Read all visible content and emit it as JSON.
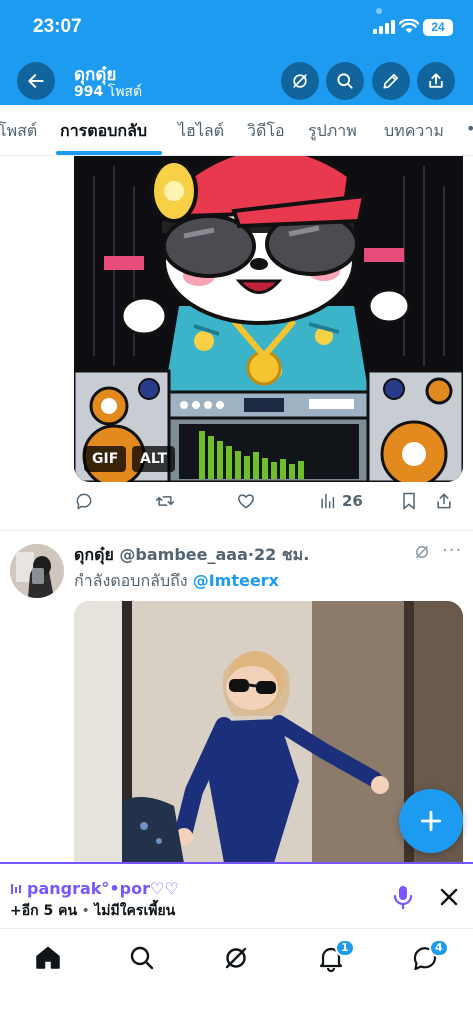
{
  "status": {
    "time": "23:07",
    "battery": "24"
  },
  "header": {
    "name": "ดุกดุ๋ย",
    "post_count": "994",
    "post_label": "โพสต์"
  },
  "tabs": [
    {
      "label": "โพสต์"
    },
    {
      "label": "การตอบกลับ"
    },
    {
      "label": "ไฮไลต์"
    },
    {
      "label": "วิดีโอ"
    },
    {
      "label": "รูปภาพ"
    },
    {
      "label": "บทความ"
    }
  ],
  "active_tab": "การตอบกลับ",
  "tweet1": {
    "badges": {
      "gif": "GIF",
      "alt": "ALT"
    },
    "views": "26"
  },
  "tweet2": {
    "display_name": "ดุกดุ๋ย",
    "handle": "@bambee_aaa",
    "separator": "·",
    "time": "22 ชม.",
    "reply_prefix": "กำลังตอบกลับถึง",
    "reply_to": "@Imteerx",
    "more": "···"
  },
  "spaces": {
    "title": "pangrak°•por♡♡",
    "sub_count": "+อีก 5 คน",
    "sub_sep": "•",
    "sub_status": "ไม่มีใครเพี้ยน"
  },
  "nav": {
    "notifications_badge": "1",
    "messages_badge": "4"
  },
  "colors": {
    "accent": "#1d9bf0",
    "spaces": "#7856ff",
    "text": "#0f1419",
    "muted": "#536471"
  }
}
